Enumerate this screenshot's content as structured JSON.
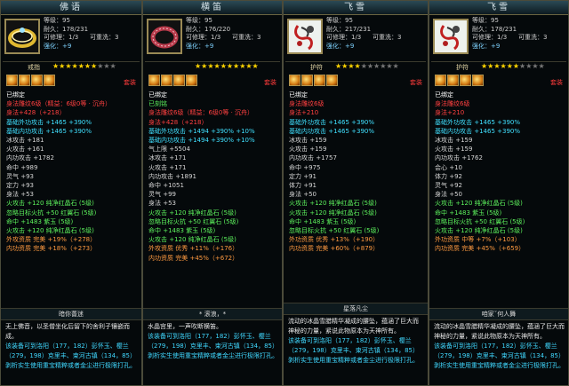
{
  "panels": [
    {
      "name": "佛语",
      "item_icon": "ring-gold-icon",
      "stat_lines": [
        "等级：95",
        "耐久：178/231",
        "可修理：1/3",
        "强化：+9"
      ],
      "reforge": "可重洗：3",
      "type": "戒指",
      "stars_on": 7,
      "stars_total": 10,
      "gem_count": 4,
      "gem_tag": "套装",
      "attrs": [
        {
          "text": "已绑定",
          "cls": "w"
        },
        {
          "text": "身法雕纹6级（精益：6级0等 · 沉舟）",
          "cls": "r"
        },
        {
          "text": "身法+428（+218）",
          "cls": "r"
        },
        {
          "text": "基础外功攻击 +1465 +390%",
          "cls": "c"
        },
        {
          "text": "基础内功攻击 +1465 +390%",
          "cls": "c"
        },
        {
          "text": "冰攻击 +181",
          "cls": ""
        },
        {
          "text": "火攻击 +161",
          "cls": ""
        },
        {
          "text": "内功攻击 +1782",
          "cls": ""
        },
        {
          "text": "命中 +989",
          "cls": ""
        },
        {
          "text": "灵气 +93",
          "cls": ""
        },
        {
          "text": "定力 +93",
          "cls": ""
        },
        {
          "text": "身法 +53",
          "cls": ""
        },
        {
          "text": "火攻击 +120  纯净红晶石 (5级)",
          "cls": "g"
        },
        {
          "text": "忽略目标火抗 +50  红翼石 (5级)",
          "cls": "g"
        },
        {
          "text": "命中 +1483  紫玉 (5级)",
          "cls": "g"
        },
        {
          "text": "火攻击 +120  纯净红晶石 (5级)",
          "cls": "g"
        },
        {
          "text": "外攻资质  完美  +19%（+278）",
          "cls": "o"
        },
        {
          "text": "内功资质  完美  +18%（+273）",
          "cls": "o"
        }
      ],
      "desc_title": "暗你薔迷",
      "desc": "无上佛音，以圣僧坐化后留下的舍利子镶嵌而成。",
      "desc_hint": "该装备可到洛阳（177，182）彭怀玉、樱兰（279，198）克里丰、束河古镇（134，85）剥析实生使用重宝精粹或者金尘进行极限打孔。"
    },
    {
      "name": "横笛",
      "item_icon": "ring-red-icon",
      "stat_lines": [
        "等级：95",
        "耐久：176/220",
        "可修理：1/3",
        "强化：+9"
      ],
      "reforge": "可重洗：3",
      "type": "",
      "stars_on": 10,
      "stars_total": 10,
      "gem_count": 4,
      "gem_tag": "套装",
      "attrs": [
        {
          "text": "已绑定",
          "cls": "w"
        },
        {
          "text": "已刻铭",
          "cls": "g"
        },
        {
          "text": "身法雕纹6级（精益：6级0等 · 沉舟）",
          "cls": "r"
        },
        {
          "text": "身法+428（+218）",
          "cls": "r"
        },
        {
          "text": "基础外功攻击 +1494 +390% +10%",
          "cls": "c"
        },
        {
          "text": "基础内功攻击 +1494 +390% +10%",
          "cls": "c"
        },
        {
          "text": "气上限 +5504",
          "cls": ""
        },
        {
          "text": "冰攻击 +171",
          "cls": ""
        },
        {
          "text": "火攻击 +171",
          "cls": ""
        },
        {
          "text": "内功攻击 +1891",
          "cls": ""
        },
        {
          "text": "命中 +1051",
          "cls": ""
        },
        {
          "text": "灵气 +99",
          "cls": ""
        },
        {
          "text": "身法 +53",
          "cls": ""
        },
        {
          "text": "火攻击 +120  纯净红晶石 (5级)",
          "cls": "g"
        },
        {
          "text": "忽略目标火抗 +50  红翼石 (5级)",
          "cls": "g"
        },
        {
          "text": "命中 +1483  紫玉 (5级)",
          "cls": "g"
        },
        {
          "text": "火攻击 +120  纯净红晶石 (5级)",
          "cls": "g"
        },
        {
          "text": "外攻资质  优秀  +11%（+176）",
          "cls": "o"
        },
        {
          "text": "内功资质  完美  +45%（+672）",
          "cls": "o"
        }
      ],
      "desc_title": "* 滚浪，*",
      "desc": "水晶宫里，一声吹断横笛。",
      "desc_hint": "该装备可到洛阳（177，182）彭怀玉、樱兰（279，198）克里丰、束河古镇（134，85）剥析实生使用重宝精粹或者金尘进行极限打孔。"
    },
    {
      "name": "飞雪",
      "item_icon": "amulet-icon",
      "stat_lines": [
        "等级：95",
        "耐久：217/231",
        "可修理：1/3",
        "强化：+9"
      ],
      "reforge": "可重洗：3",
      "type": "护符",
      "stars_on": 4,
      "stars_total": 10,
      "gem_count": 4,
      "gem_tag": "套装",
      "attrs": [
        {
          "text": "已绑定",
          "cls": "w"
        },
        {
          "text": "身法雕纹6级",
          "cls": "r"
        },
        {
          "text": "身法+210",
          "cls": "r"
        },
        {
          "text": "基础外功攻击 +1465 +390%",
          "cls": "c"
        },
        {
          "text": "基础内功攻击 +1465 +390%",
          "cls": "c"
        },
        {
          "text": "冰攻击 +159",
          "cls": ""
        },
        {
          "text": "火攻击 +159",
          "cls": ""
        },
        {
          "text": "内功攻击 +1757",
          "cls": ""
        },
        {
          "text": "命中 +975",
          "cls": ""
        },
        {
          "text": "定力 +91",
          "cls": ""
        },
        {
          "text": "体力 +91",
          "cls": ""
        },
        {
          "text": "身法 +50",
          "cls": ""
        },
        {
          "text": "火攻击 +120  纯净红晶石 (5级)",
          "cls": "g"
        },
        {
          "text": "火攻击 +120  纯净红晶石 (5级)",
          "cls": "g"
        },
        {
          "text": "命中 +1483  紫玉 (5级)",
          "cls": "g"
        },
        {
          "text": "忽略目标火抗 +50  红翼石 (5级)",
          "cls": "g"
        },
        {
          "text": "外功资质  优秀  +13%（+190）",
          "cls": "o"
        },
        {
          "text": "内功资质  完美  +60%（+879）",
          "cls": "o"
        }
      ],
      "desc_title": "星落凡尘",
      "desc": "流动的冰晶雪腊精华凝成的腰坠，蕴涵了巨大而神秘的力量，紧说此物原本为天神所有。",
      "desc_hint": "该装备可到洛阳（177，182）彭怀玉、樱兰（279，198）克里丰、束河古镇（134，85）剥析实生使用重宝精粹或者金尘进行极限打孔。"
    },
    {
      "name": "飞雪",
      "item_icon": "amulet-icon",
      "stat_lines": [
        "等级：95",
        "耐久：178/231",
        "可修理：1/3",
        "强化：+9"
      ],
      "reforge": "可重洗：3",
      "type": "护符",
      "stars_on": 6,
      "stars_total": 10,
      "gem_count": 4,
      "gem_tag": "套装",
      "attrs": [
        {
          "text": "已绑定",
          "cls": "w"
        },
        {
          "text": "身法雕纹6级",
          "cls": "r"
        },
        {
          "text": "身法+210",
          "cls": "r"
        },
        {
          "text": "基础外功攻击 +1465 +390%",
          "cls": "c"
        },
        {
          "text": "基础内功攻击 +1465 +390%",
          "cls": "c"
        },
        {
          "text": "冰攻击 +159",
          "cls": ""
        },
        {
          "text": "火攻击 +159",
          "cls": ""
        },
        {
          "text": "内功攻击 +1762",
          "cls": ""
        },
        {
          "text": "会心 +10",
          "cls": ""
        },
        {
          "text": "体力 +92",
          "cls": ""
        },
        {
          "text": "灵气 +92",
          "cls": ""
        },
        {
          "text": "身法 +50",
          "cls": ""
        },
        {
          "text": "火攻击 +120  纯净红晶石 (5级)",
          "cls": "g"
        },
        {
          "text": "命中 +1483  紫玉 (5级)",
          "cls": "g"
        },
        {
          "text": "忽略目标火抗 +50  红翼石 (5级)",
          "cls": "g"
        },
        {
          "text": "火攻击 +120  纯净红晶石 (5级)",
          "cls": "g"
        },
        {
          "text": "外功资质  中等  +7%（+103）",
          "cls": "o"
        },
        {
          "text": "内功资质  完美  +45%（+659）",
          "cls": "o"
        }
      ],
      "desc_title": "咱家ˇ何人舞",
      "desc": "流动的冰晶雪腊精华凝成的腰坠，蕴涵了巨大而神秘的力量，紧说此物原本为天神所有。",
      "desc_hint": "该装备可到洛阳（177，182）彭怀玉、樱兰（279，198）克里丰、束河古镇（134，85）剥析实生使用重宝精粹或者金尘进行极限打孔。"
    }
  ],
  "colors": {
    "title_bg": "#2b4a55",
    "border": "#9a8a55",
    "accent_red": "#ff4040",
    "accent_cyan": "#40e0ff",
    "accent_green": "#5cf05c"
  }
}
